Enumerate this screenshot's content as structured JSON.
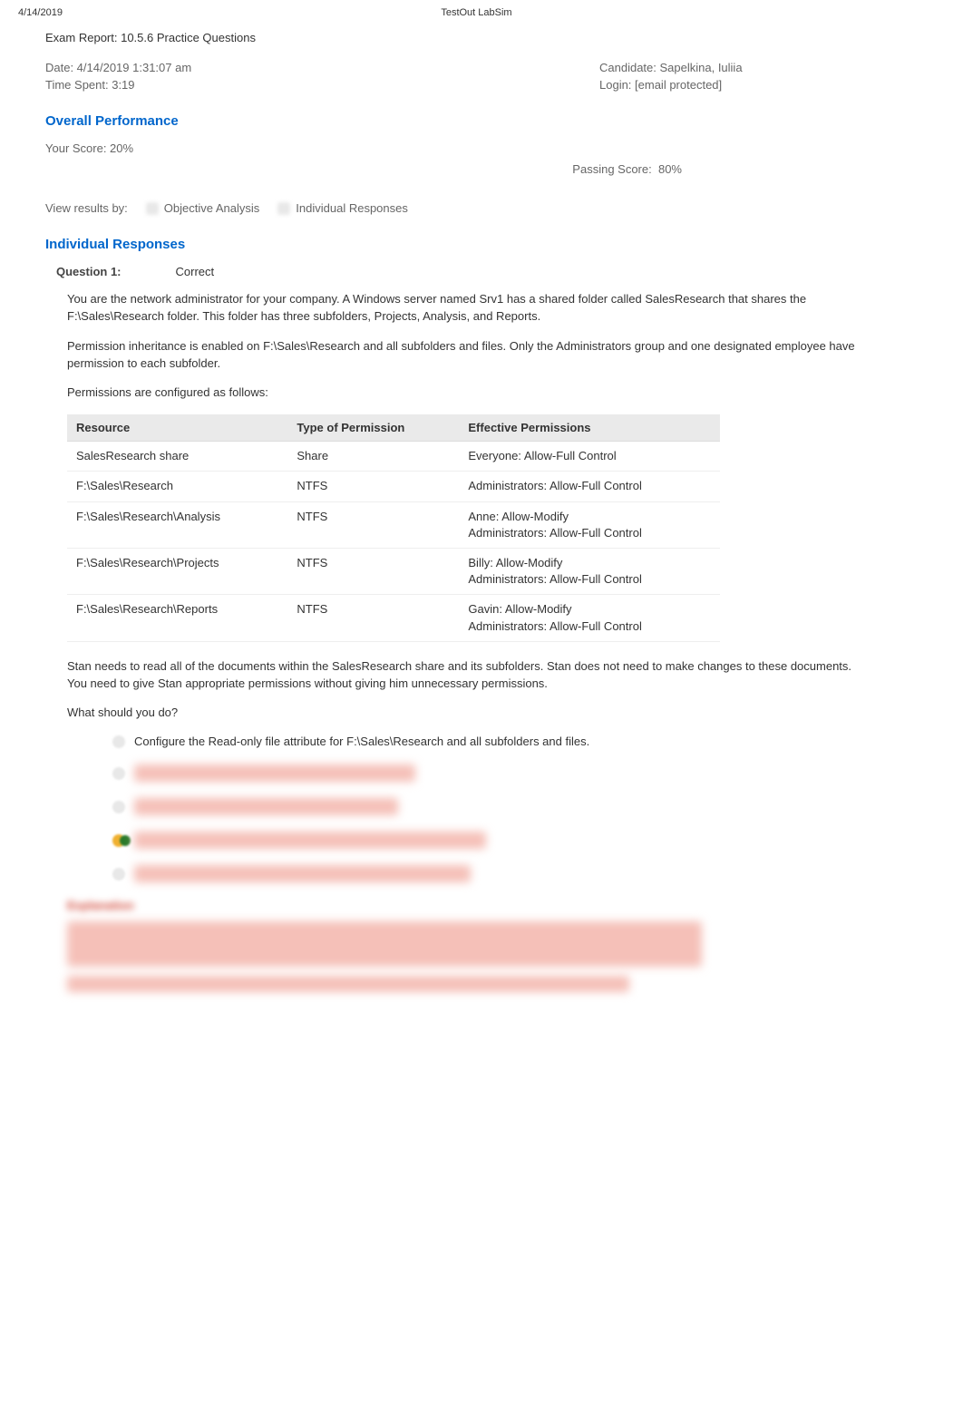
{
  "header": {
    "date_label": "4/14/2019",
    "app_title": "TestOut LabSim"
  },
  "report": {
    "title": "Exam Report: 10.5.6 Practice Questions",
    "date": "Date: 4/14/2019 1:31:07 am",
    "time_spent": "Time Spent: 3:19",
    "candidate": "Candidate: Sapelkina, Iuliia",
    "login": "Login: [email protected]"
  },
  "performance": {
    "title": "Overall Performance",
    "score": "Your Score: 20%",
    "passing_label": "Passing Score:",
    "passing_value": "80%"
  },
  "view": {
    "label": "View results by:",
    "opt1": "Objective Analysis",
    "opt2": "Individual Responses"
  },
  "responses": {
    "title": "Individual Responses",
    "q1_label": "Question 1:",
    "q1_status": "Correct",
    "para1": "You are the network administrator for your company. A Windows server named Srv1 has a shared folder called SalesResearch that shares the F:\\Sales\\Research folder. This folder has three subfolders, Projects, Analysis, and Reports.",
    "para2": "Permission inheritance is enabled on F:\\Sales\\Research and all subfolders and files. Only the Administrators group and one designated employee have permission to each subfolder.",
    "para3": "Permissions are configured as follows:",
    "table": {
      "headers": [
        "Resource",
        "Type of Permission",
        "Effective Permissions"
      ],
      "rows": [
        [
          "SalesResearch share",
          "Share",
          "Everyone: Allow-Full Control"
        ],
        [
          "F:\\Sales\\Research",
          "NTFS",
          "Administrators: Allow-Full Control"
        ],
        [
          "F:\\Sales\\Research\\Analysis",
          "NTFS",
          "Anne: Allow-Modify\nAdministrators: Allow-Full Control"
        ],
        [
          "F:\\Sales\\Research\\Projects",
          "NTFS",
          "Billy: Allow-Modify\nAdministrators: Allow-Full Control"
        ],
        [
          "F:\\Sales\\Research\\Reports",
          "NTFS",
          "Gavin: Allow-Modify\nAdministrators: Allow-Full Control"
        ]
      ]
    },
    "para4": "Stan needs to read all of the documents within the SalesResearch share and its subfolders. Stan does not need to make changes to these documents. You need to give Stan appropriate permissions without giving him unnecessary permissions.",
    "para5": "What should you do?",
    "answers": {
      "a1": "Configure the Read-only file attribute for F:\\Sales\\Research and all subfolders and files.",
      "a2_blur": "Disable permission inheritance on F Sales Research",
      "a3_blur": "Make Stan a member of the Administrators group",
      "a4_blur": "Assign Stan the Allow read NTFS permission to F Sales Research",
      "a5_blur": "Assign Stan the Allow read share permission to SalesResearch"
    },
    "explanation_title": "Explanation"
  }
}
